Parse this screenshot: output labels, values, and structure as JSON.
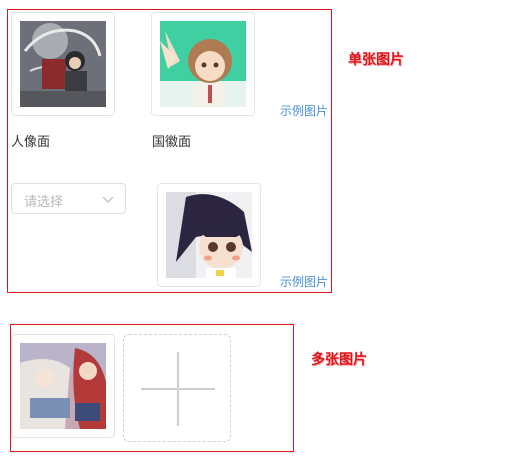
{
  "single": {
    "annotation": "单张图片",
    "portrait_label": "人像面",
    "emblem_label": "国徽面",
    "example_link_1": "示例图片",
    "example_link_2": "示例图片",
    "select_placeholder": "请选择"
  },
  "multiple": {
    "annotation": "多张图片"
  },
  "icons": [
    "chevron-down-icon",
    "plus-icon"
  ],
  "colors": {
    "annotation": "#e0151b",
    "link": "#4a90d9",
    "border": "#e0151b"
  }
}
